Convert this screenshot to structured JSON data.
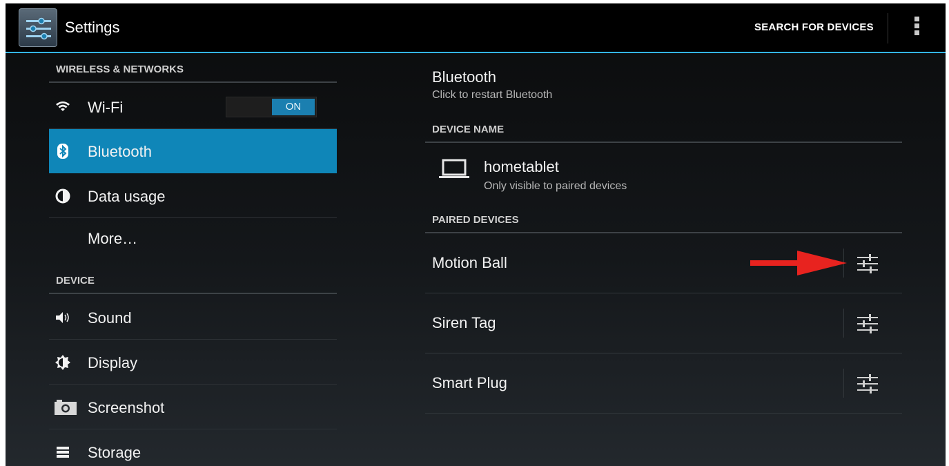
{
  "actionbar": {
    "app_icon": "settings-sliders-icon",
    "title": "Settings",
    "search_action": "SEARCH FOR DEVICES",
    "overflow_icon": "overflow-menu-icon"
  },
  "left": {
    "sections": [
      {
        "header": "WIRELESS & NETWORKS",
        "items": [
          {
            "label": "Wi-Fi",
            "icon": "wifi-icon",
            "toggle": "ON"
          },
          {
            "label": "Bluetooth",
            "icon": "bluetooth-icon",
            "active": true
          },
          {
            "label": "Data usage",
            "icon": "data-usage-icon"
          },
          {
            "label": "More…",
            "icon": ""
          }
        ]
      },
      {
        "header": "DEVICE",
        "items": [
          {
            "label": "Sound",
            "icon": "sound-icon"
          },
          {
            "label": "Display",
            "icon": "display-icon"
          },
          {
            "label": "Screenshot",
            "icon": "camera-icon"
          },
          {
            "label": "Storage",
            "icon": "storage-icon"
          }
        ]
      }
    ]
  },
  "right": {
    "bluetooth_title": "Bluetooth",
    "bluetooth_sub": "Click to restart Bluetooth",
    "device_name_header": "DEVICE NAME",
    "device": {
      "name": "hometablet",
      "sub": "Only visible to paired devices",
      "icon": "laptop-icon"
    },
    "paired_header": "PAIRED DEVICES",
    "paired": [
      {
        "label": "Motion Ball",
        "button_icon": "device-settings-icon"
      },
      {
        "label": "Siren Tag",
        "button_icon": "device-settings-icon"
      },
      {
        "label": "Smart Plug",
        "button_icon": "device-settings-icon"
      }
    ]
  },
  "annotation": {
    "icon": "red-arrow-icon",
    "color": "#e8231f"
  },
  "colors": {
    "accent": "#33b5e5",
    "selected": "#0f86b8"
  }
}
